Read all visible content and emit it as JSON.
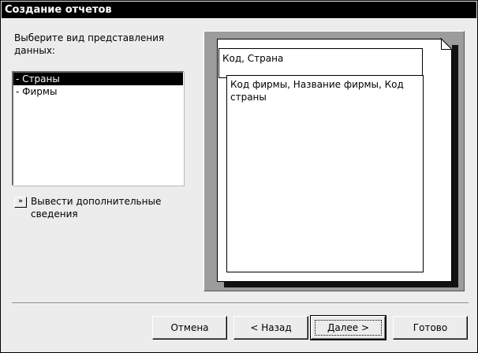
{
  "window": {
    "title": "Создание отчетов"
  },
  "prompt": {
    "text": "Выберите вид представления данных:"
  },
  "view_list": {
    "items": [
      "- Страны",
      "- Фирмы"
    ],
    "selected_index": 0
  },
  "more_info": {
    "button_glyph": "»",
    "label": "Вывести дополнительные сведения"
  },
  "preview": {
    "header_fields": "Код, Страна",
    "detail_fields": "Код фирмы, Название фирмы, Код страны"
  },
  "buttons": {
    "cancel": "Отмена",
    "back": "< Назад",
    "next": "Далее >",
    "finish": "Готово"
  }
}
